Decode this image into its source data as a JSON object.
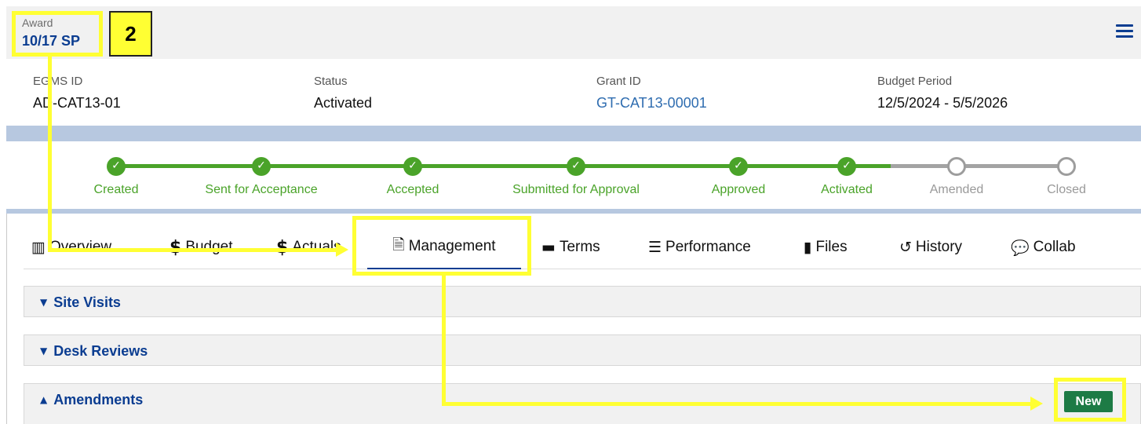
{
  "header": {
    "award_label": "Award",
    "award_name": "10/17 SP",
    "menu_icon": "hamburger-menu-icon"
  },
  "details": {
    "egms_id": {
      "label": "EGMS ID",
      "value": "AD-CAT13-01"
    },
    "status": {
      "label": "Status",
      "value": "Activated"
    },
    "grant_id": {
      "label": "Grant ID",
      "value": "GT-CAT13-00001"
    },
    "budget_period": {
      "label": "Budget Period",
      "value": "12/5/2024 - 5/5/2026"
    }
  },
  "progress": {
    "colors": {
      "complete": "#4aa329",
      "pending": "#a3a3a3"
    },
    "steps": [
      {
        "label": "Created",
        "state": "complete"
      },
      {
        "label": "Sent for Acceptance",
        "state": "complete"
      },
      {
        "label": "Accepted",
        "state": "complete"
      },
      {
        "label": "Submitted for Approval",
        "state": "complete"
      },
      {
        "label": "Approved",
        "state": "complete"
      },
      {
        "label": "Activated",
        "state": "complete"
      },
      {
        "label": "Amended",
        "state": "pending"
      },
      {
        "label": "Closed",
        "state": "pending"
      }
    ]
  },
  "tabs": [
    {
      "label": "Overview",
      "icon": "overview-icon"
    },
    {
      "label": "Budget",
      "icon": "dollar-icon"
    },
    {
      "label": "Actuals",
      "icon": "dollar-icon"
    },
    {
      "label": "Management",
      "icon": "document-icon",
      "active": true
    },
    {
      "label": "Terms",
      "icon": "folder-icon"
    },
    {
      "label": "Performance",
      "icon": "server-icon"
    },
    {
      "label": "Files",
      "icon": "file-icon"
    },
    {
      "label": "History",
      "icon": "history-icon"
    },
    {
      "label": "Collab",
      "icon": "chat-icon"
    }
  ],
  "sections": [
    {
      "title": "Site Visits",
      "expanded": false
    },
    {
      "title": "Desk Reviews",
      "expanded": false
    },
    {
      "title": "Amendments",
      "expanded": true
    }
  ],
  "new_button_label": "New",
  "callout_number": "2",
  "annotation_color": "#ffff33"
}
